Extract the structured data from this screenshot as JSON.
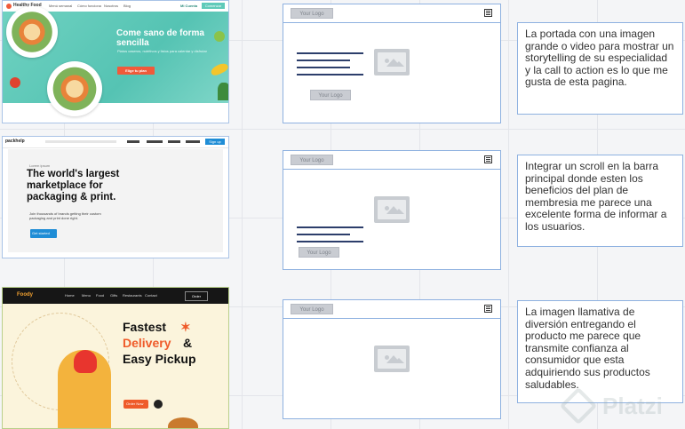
{
  "screenshots": [
    {
      "brand": "Healthy Food",
      "nav_links": [
        "Menú semanal",
        "Cómo funciona",
        "Nosotros",
        "Blog"
      ],
      "nav_login": "Mi Cuenta",
      "nav_cta": "Comenzar",
      "hero_title": "Come sano de forma sencilla",
      "hero_sub": "Platos caseros, nutritivos y listos para calentar y disfrutar",
      "cta": "Elige tu plan",
      "accent": "#f05a3a",
      "bg": "#5fcab9"
    },
    {
      "brand": "packhelp",
      "nav_cta": "Sign up",
      "eyebrow": "Lorem ipsum",
      "hero_title": "The world's largest marketplace for packaging & print.",
      "hero_sub": "Join thousands of brands getting their custom packaging and print done right.",
      "cta": "Get started",
      "accent": "#1f8dd6"
    },
    {
      "brand": "Foody",
      "nav_links": [
        "Home",
        "Menu",
        "Food",
        "Gifts",
        "Restaurants",
        "Contact"
      ],
      "nav_cta": "Order",
      "hero_line1": "Fastest",
      "hero_line2": "Delivery",
      "hero_amp": "&",
      "hero_line3": "Easy Pickup",
      "cta": "Order Now",
      "accent": "#ef5b2a",
      "green": "#3a9a3f"
    }
  ],
  "wireframes": [
    {
      "logo": "Your Logo",
      "footer_logo": "Your Logo",
      "icon": "hamburger-menu-icon",
      "image_icon": "image-placeholder-icon"
    },
    {
      "logo": "Your Logo",
      "footer_logo": "Your Logo",
      "icon": "hamburger-menu-icon",
      "image_icon": "image-placeholder-icon"
    },
    {
      "logo": "Your Logo",
      "icon": "hamburger-menu-icon",
      "image_icon": "image-placeholder-icon"
    }
  ],
  "notes": [
    "La portada con una imagen grande o video para mostrar un storytelling de su especialidad y la call to action es lo que me gusta de esta pagina.",
    "Integrar un scroll en la barra principal donde esten los beneficios del plan de membresia me parece una excelente forma de informar a los usuarios.",
    "La imagen llamativa de diversión entregando el producto me parece que transmite confianza al consumidor que esta adquiriendo sus productos saludables."
  ],
  "watermark": "Platzi"
}
